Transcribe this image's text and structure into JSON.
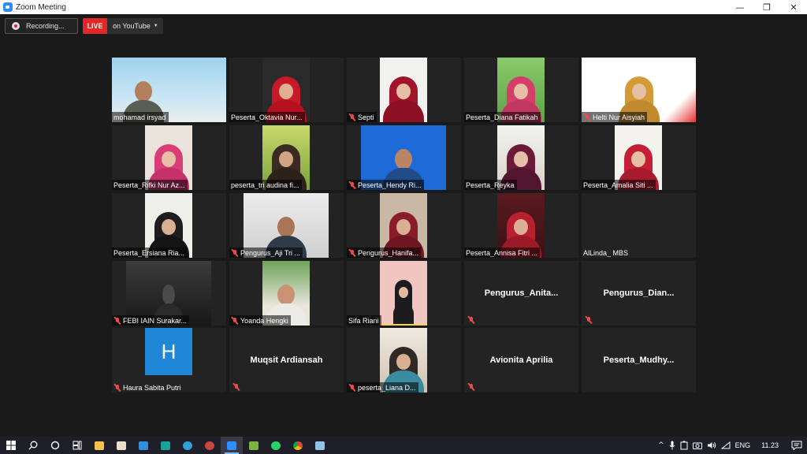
{
  "window": {
    "title": "Zoom Meeting",
    "controls": {
      "minimize": "—",
      "restore": "❐",
      "close": "✕"
    }
  },
  "toolbar": {
    "recording_label": "Recording...",
    "live_badge": "LIVE",
    "live_target": "on YouTube",
    "dropdown_glyph": "▼"
  },
  "participants": [
    {
      "name": "mohamad irsyad",
      "muted": false,
      "video": true
    },
    {
      "name": "Peserta_Oktavia Nur...",
      "muted": false,
      "video": true
    },
    {
      "name": "Septi",
      "muted": true,
      "video": true
    },
    {
      "name": "Peserta_Diana Fatikah",
      "muted": false,
      "video": true
    },
    {
      "name": "Helti Nur Aisyiah",
      "muted": true,
      "video": true
    },
    {
      "name": "Peserta_Rifki Nur Az...",
      "muted": false,
      "video": true
    },
    {
      "name": "peserta_tri audina fi...",
      "muted": false,
      "video": true
    },
    {
      "name": "Peserta_Hendy Ri...",
      "muted": true,
      "video": true
    },
    {
      "name": "Peserta_Reyka",
      "muted": false,
      "video": true
    },
    {
      "name": "Peserta_Amalia Siti ...",
      "muted": false,
      "video": true
    },
    {
      "name": "Peserta_Ersiana Ria...",
      "muted": false,
      "video": true
    },
    {
      "name": "Pengurus_Aji Tri ...",
      "muted": true,
      "video": true
    },
    {
      "name": "Pengurus_Hanifa...",
      "muted": true,
      "video": true
    },
    {
      "name": "Peserta_Annisa Fitri ...",
      "muted": false,
      "video": true
    },
    {
      "name": "AlLinda_ MBS",
      "muted": false,
      "video": false
    },
    {
      "name": "FEBI IAIN Surakar...",
      "muted": true,
      "video": true
    },
    {
      "name": "Yoanda Hengki",
      "muted": true,
      "video": true
    },
    {
      "name": "Sifa Riani",
      "muted": false,
      "video": true
    },
    {
      "name": "Pengurus_Anita...",
      "muted": true,
      "video": false
    },
    {
      "name": "Pengurus_Dian...",
      "muted": true,
      "video": false
    },
    {
      "name": "Haura Sabita Putri",
      "muted": true,
      "video": false,
      "avatar_letter": "H"
    },
    {
      "name": "Muqsit Ardiansah",
      "muted": true,
      "video": false
    },
    {
      "name": "peserta_Liana D...",
      "muted": true,
      "video": true
    },
    {
      "name": "Avionita Aprilia",
      "muted": true,
      "video": false
    },
    {
      "name": "Peserta_Mudhy...",
      "muted": false,
      "video": false
    }
  ],
  "taskbar": {
    "tray_language": "ENG",
    "tray_time": "11.23",
    "tray_chevron": "^"
  },
  "colors": {
    "live": "#e02828",
    "muted_mic": "#e94b4b",
    "avatar_blue": "#1f87d6",
    "background": "#1a1a1a",
    "tile": "#232323"
  }
}
